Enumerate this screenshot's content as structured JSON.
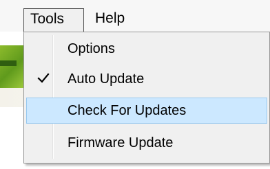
{
  "menubar": {
    "menus": [
      {
        "label": "Tools"
      },
      {
        "label": "Help"
      }
    ]
  },
  "dropdown": {
    "items": [
      {
        "label": "Options",
        "checked": false,
        "highlighted": false
      },
      {
        "label": "Auto Update",
        "checked": true,
        "highlighted": false,
        "icon": "checkmark-icon"
      },
      {
        "label": "Check For Updates",
        "checked": false,
        "highlighted": true
      },
      {
        "label": "Firmware Update",
        "checked": false,
        "highlighted": false
      }
    ]
  },
  "colors": {
    "highlight_fill": "#cce8ff",
    "highlight_border": "#99c9ef",
    "menu_background": "#f0f0f0"
  }
}
